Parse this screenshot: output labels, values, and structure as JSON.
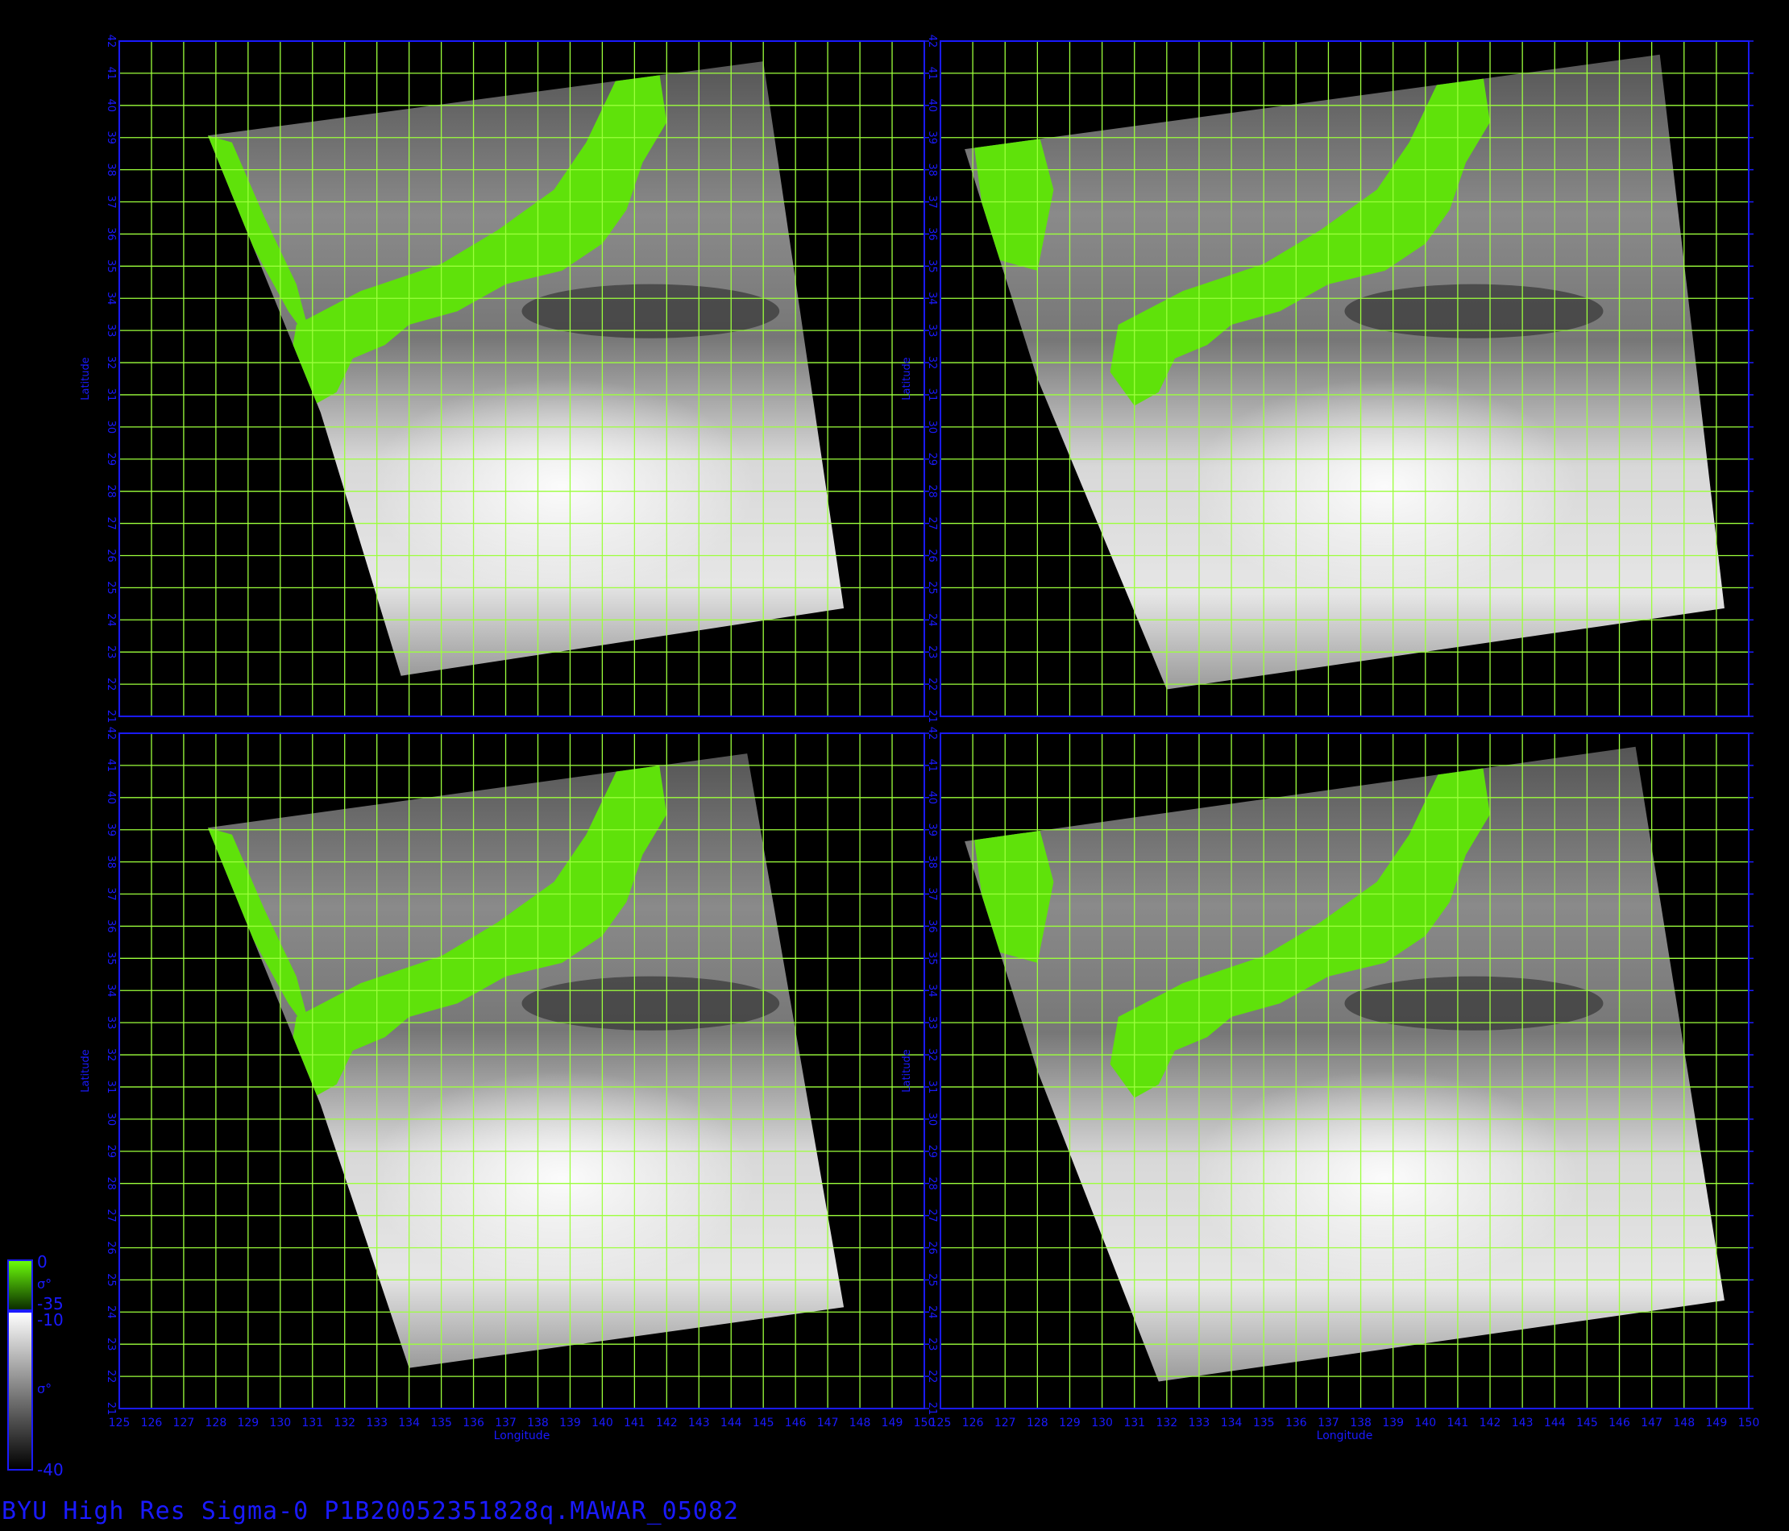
{
  "footer_title": "BYU High Res Sigma-0 P1B20052351828q.MAWAR_05082",
  "axis_labels": {
    "longitude": "Longitude",
    "latitude": "Latitude"
  },
  "longitude_ticks": [
    "125",
    "126",
    "127",
    "128",
    "129",
    "130",
    "131",
    "132",
    "133",
    "134",
    "135",
    "136",
    "137",
    "138",
    "139",
    "140",
    "141",
    "142",
    "143",
    "144",
    "145",
    "146",
    "147",
    "148",
    "149",
    "150"
  ],
  "latitude_ticks": [
    "21",
    "22",
    "23",
    "24",
    "25",
    "26",
    "27",
    "28",
    "29",
    "30",
    "31",
    "32",
    "33",
    "34",
    "35",
    "36",
    "37",
    "38",
    "39",
    "40",
    "41",
    "42"
  ],
  "colorbar": {
    "land_range": {
      "max": "0",
      "min": "-35",
      "symbol": "σ°"
    },
    "ocean_range": {
      "max": "-10",
      "min": "-40",
      "symbol": "σ°"
    }
  },
  "colors": {
    "frame": "#1a1aff",
    "grid": "#9cff3c",
    "land": "#5fe20a",
    "background": "#000000"
  },
  "panels": [
    {
      "id": "top-left"
    },
    {
      "id": "top-right"
    },
    {
      "id": "bottom-left"
    },
    {
      "id": "bottom-right"
    }
  ]
}
